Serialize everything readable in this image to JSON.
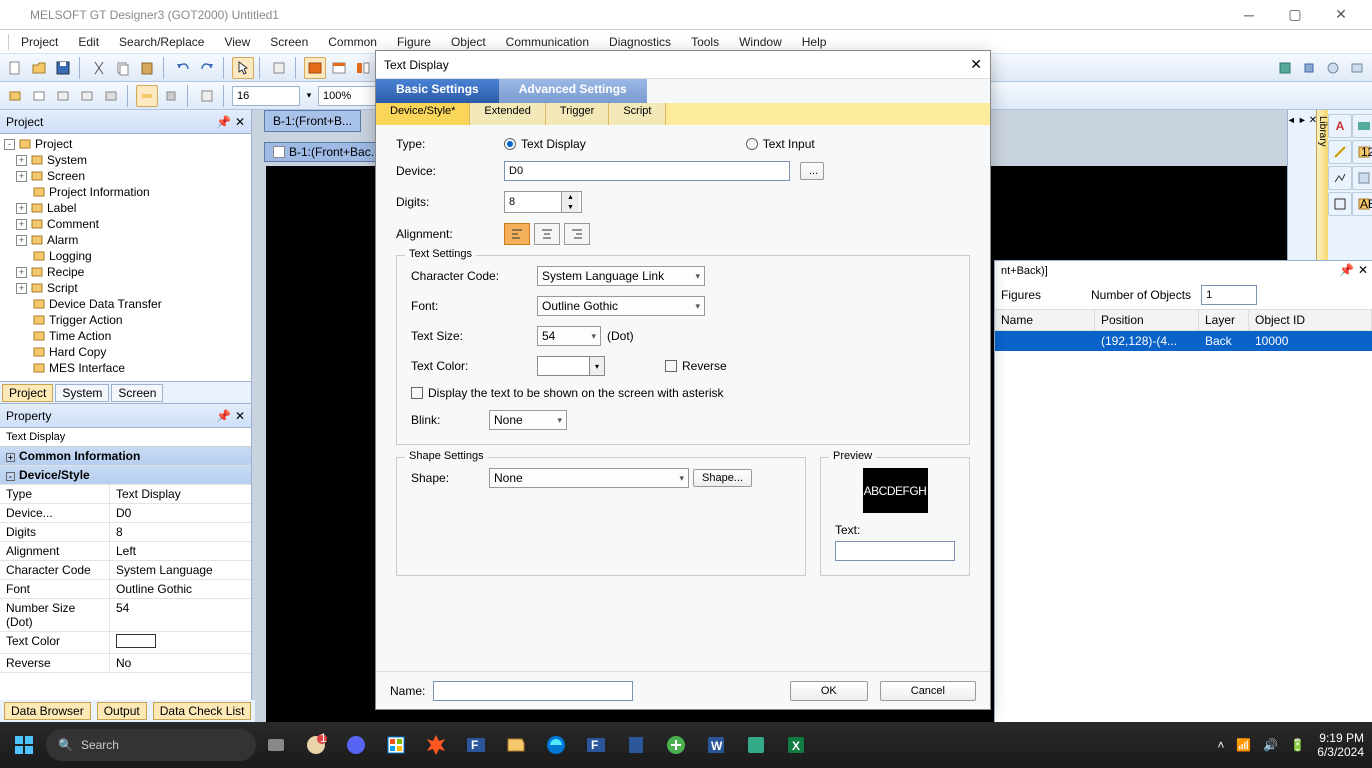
{
  "app": {
    "title": "MELSOFT GT Designer3 (GOT2000) Untitled1"
  },
  "menu": [
    "Project",
    "Edit",
    "Search/Replace",
    "View",
    "Screen",
    "Common",
    "Figure",
    "Object",
    "Communication",
    "Diagnostics",
    "Tools",
    "Window",
    "Help"
  ],
  "toolbar_font_size": "16",
  "toolbar_zoom": "100%",
  "panels": {
    "project_header": "Project",
    "property_header": "Property",
    "property_title": "Text Display"
  },
  "tree": [
    {
      "label": "Project",
      "exp": "-",
      "indent": 0
    },
    {
      "label": "System",
      "exp": "+",
      "indent": 1
    },
    {
      "label": "Screen",
      "exp": "+",
      "indent": 1
    },
    {
      "label": "Project Information",
      "exp": "",
      "indent": 1
    },
    {
      "label": "Label",
      "exp": "+",
      "indent": 1
    },
    {
      "label": "Comment",
      "exp": "+",
      "indent": 1
    },
    {
      "label": "Alarm",
      "exp": "+",
      "indent": 1
    },
    {
      "label": "Logging",
      "exp": "",
      "indent": 1
    },
    {
      "label": "Recipe",
      "exp": "+",
      "indent": 1
    },
    {
      "label": "Script",
      "exp": "+",
      "indent": 1
    },
    {
      "label": "Device Data Transfer",
      "exp": "",
      "indent": 1
    },
    {
      "label": "Trigger Action",
      "exp": "",
      "indent": 1
    },
    {
      "label": "Time Action",
      "exp": "",
      "indent": 1
    },
    {
      "label": "Hard Copy",
      "exp": "",
      "indent": 1
    },
    {
      "label": "MES Interface",
      "exp": "",
      "indent": 1
    }
  ],
  "left_tabs": [
    "Project",
    "System",
    "Screen"
  ],
  "properties": {
    "groups": [
      {
        "name": "Common Information",
        "exp": "+"
      },
      {
        "name": "Device/Style",
        "exp": "-"
      }
    ],
    "rows": [
      {
        "k": "Type",
        "v": "Text Display"
      },
      {
        "k": "Device...",
        "v": "D0"
      },
      {
        "k": "Digits",
        "v": "8"
      },
      {
        "k": "Alignment",
        "v": "Left"
      },
      {
        "k": "Character Code",
        "v": "System Language"
      },
      {
        "k": "Font",
        "v": "Outline Gothic"
      },
      {
        "k": "Number Size (Dot)",
        "v": "54"
      },
      {
        "k": "Text Color",
        "v": ""
      },
      {
        "k": "Reverse",
        "v": "No"
      }
    ]
  },
  "bottom_tabs": [
    "Data Browser",
    "Output",
    "Data Check List"
  ],
  "canvas_tab": "B-1:(Front+B...",
  "canvas_tab2": "B-1:(Front+Bac...",
  "right_panel": {
    "header_suffix": "nt+Back)]",
    "figures_label": "Figures",
    "num_objects_label": "Number of Objects",
    "num_objects": "1",
    "cols": {
      "c1": "Name",
      "c2": "Position",
      "c3": "Layer",
      "c4": "Object ID"
    },
    "row": {
      "pos": "(192,128)-(4...",
      "layer": "Back",
      "id": "10000"
    }
  },
  "rs_lib_label": "Library",
  "dialog": {
    "title": "Text Display",
    "tabs1": {
      "basic": "Basic Settings",
      "adv": "Advanced Settings"
    },
    "tabs2": [
      "Device/Style*",
      "Extended",
      "Trigger",
      "Script"
    ],
    "labels": {
      "type": "Type:",
      "type_opt1": "Text Display",
      "type_opt2": "Text Input",
      "device": "Device:",
      "device_val": "D0",
      "device_btn": "...",
      "digits": "Digits:",
      "digits_val": "8",
      "alignment": "Alignment:",
      "text_settings": "Text Settings",
      "char_code": "Character Code:",
      "char_code_val": "System Language Link",
      "font": "Font:",
      "font_val": "Outline Gothic",
      "text_size": "Text Size:",
      "text_size_val": "54",
      "text_size_unit": "(Dot)",
      "text_color": "Text Color:",
      "reverse": "Reverse",
      "asterisk": "Display the text to be shown on the screen with asterisk",
      "blink": "Blink:",
      "blink_val": "None",
      "shape_settings": "Shape Settings",
      "shape": "Shape:",
      "shape_val": "None",
      "shape_btn": "Shape...",
      "preview": "Preview",
      "preview_sample": "ABCDEFGH",
      "preview_text_lbl": "Text:",
      "name": "Name:",
      "ok": "OK",
      "cancel": "Cancel"
    }
  },
  "taskbar": {
    "search_placeholder": "Search",
    "time": "9:19 PM",
    "date": "6/3/2024"
  }
}
